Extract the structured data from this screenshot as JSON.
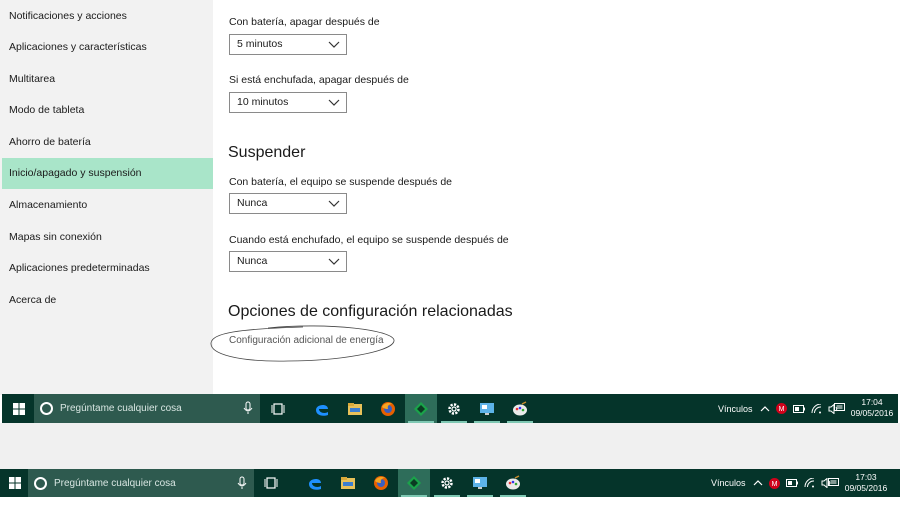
{
  "sidebar": {
    "items": [
      {
        "label": "Notificaciones y acciones",
        "selected": false
      },
      {
        "label": "Aplicaciones y características",
        "selected": false
      },
      {
        "label": "Multitarea",
        "selected": false
      },
      {
        "label": "Modo de tableta",
        "selected": false
      },
      {
        "label": "Ahorro de batería",
        "selected": false
      },
      {
        "label": "Inicio/apagado y suspensión",
        "selected": true
      },
      {
        "label": "Almacenamiento",
        "selected": false
      },
      {
        "label": "Mapas sin conexión",
        "selected": false
      },
      {
        "label": "Aplicaciones predeterminadas",
        "selected": false
      },
      {
        "label": "Acerca de",
        "selected": false
      }
    ]
  },
  "screen": {
    "battery_label": "Con batería, apagar después de",
    "battery_value": "5 minutos",
    "plugged_label": "Si está enchufada, apagar después de",
    "plugged_value": "10 minutos"
  },
  "sleep": {
    "heading": "Suspender",
    "battery_label": "Con batería, el equipo se suspende después de",
    "battery_value": "Nunca",
    "plugged_label": "Cuando está enchufado, el equipo se suspende después de",
    "plugged_value": "Nunca"
  },
  "related": {
    "heading": "Opciones de configuración relacionadas",
    "link": "Configuración adicional de energía"
  },
  "taskbar_top": {
    "search_placeholder": "Pregúntame cualquier cosa",
    "links_label": "Vínculos",
    "time": "17:04",
    "date": "09/05/2016"
  },
  "taskbar_bottom": {
    "search_placeholder": "Pregúntame cualquier cosa",
    "links_label": "Vínculos",
    "time": "17:03",
    "date": "09/05/2016"
  },
  "colors": {
    "accent_selected": "#a9e5c9",
    "taskbar": "#05342a",
    "taskbar_search": "#2e5a4f"
  },
  "icons": [
    "windows-start-icon",
    "cortana-search-icon",
    "microphone-icon",
    "task-view-icon",
    "edge-icon",
    "file-explorer-icon",
    "firefox-icon",
    "green-app-icon",
    "settings-gear-icon",
    "remote-desktop-icon",
    "paint-icon",
    "chevron-up-icon",
    "mcafee-icon",
    "battery-icon",
    "wifi-icon",
    "speaker-icon",
    "notifications-icon"
  ]
}
